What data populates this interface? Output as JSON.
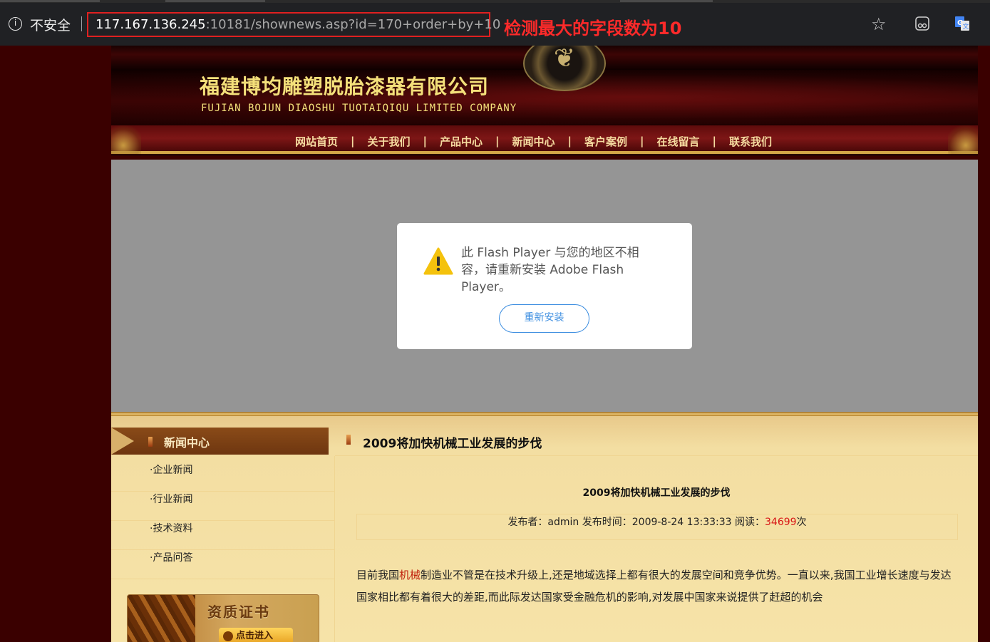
{
  "browser": {
    "security_label": "不安全",
    "url_host": "117.167.136.245",
    "url_rest": ":10181/shownews.asp?id=170+order+by+10",
    "annotation": "检测最大的字段数为10"
  },
  "header": {
    "company_cn": "福建博均雕塑脱胎漆器有限公司",
    "company_en": "FUJIAN BOJUN DIAOSHU  TUOTAIQIQU  LIMITED COMPANY"
  },
  "nav": {
    "items": [
      "网站首页",
      "关于我们",
      "产品中心",
      "新闻中心",
      "客户案例",
      "在线留言",
      "联系我们"
    ],
    "separator": "|"
  },
  "flash": {
    "message": "此 Flash Player 与您的地区不相容，请重新安装 Adobe Flash Player。",
    "button": "重新安装"
  },
  "sidebar": {
    "title": "新闻中心",
    "items": [
      "·企业新闻",
      "·行业新闻",
      "·技术资料",
      "·产品问答"
    ],
    "cert_title": "资质证书",
    "cert_button": "点击进入"
  },
  "article": {
    "section_title": "2009将加快机械工业发展的步伐",
    "title": "2009将加快机械工业发展的步伐",
    "meta_prefix": "发布者：admin 发布时间：2009-8-24 13:33:33 阅读：",
    "hits": "34699",
    "meta_suffix": "次",
    "body_pre": "目前我国",
    "body_keyword": "机械",
    "body_post": "制造业不管是在技术升级上,还是地域选择上都有很大的发展空间和竞争优势。一直以来,我国工业增长速度与发达国家相比都有着很大的差距,而此际发达国家受金融危机的影响,对发展中国家来说提供了赶超的机会"
  },
  "colors": {
    "accent_red": "#e02020",
    "hit_red": "#d81515",
    "nav_gold": "#f5dba0",
    "title_gold": "#f4e07a"
  }
}
